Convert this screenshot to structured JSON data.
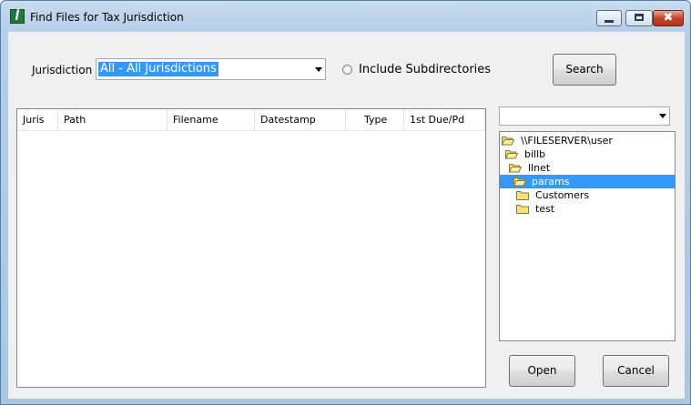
{
  "window": {
    "title": "Find Files for Tax Jurisdiction",
    "app_icon": "green-document-icon",
    "controls": {
      "minimize": "minimize-icon",
      "maximize": "maximize-icon",
      "close": "✖"
    }
  },
  "filters": {
    "jurisdiction_label": "Jurisdiction",
    "jurisdiction_value": "All - All Jurisdictions",
    "include_subdirs_label": "Include Subdirectories",
    "include_subdirs_checked": false,
    "search_label": "Search"
  },
  "results": {
    "columns": [
      "Juris",
      "Path",
      "Filename",
      "Datestamp",
      "Type",
      "1st Due/Pd"
    ],
    "rows": []
  },
  "drive": {
    "value": ""
  },
  "tree": {
    "nodes": [
      {
        "label": "\\\\FILESERVER\\user",
        "depth": 0,
        "state": "open",
        "selected": false
      },
      {
        "label": "billb",
        "depth": 1,
        "state": "open",
        "selected": false
      },
      {
        "label": "llnet",
        "depth": 2,
        "state": "open",
        "selected": false
      },
      {
        "label": "params",
        "depth": 3,
        "state": "open",
        "selected": true
      },
      {
        "label": "Customers",
        "depth": 4,
        "state": "closed",
        "selected": false
      },
      {
        "label": "test",
        "depth": 4,
        "state": "closed",
        "selected": false
      }
    ]
  },
  "actions": {
    "open_label": "Open",
    "cancel_label": "Cancel"
  },
  "colors": {
    "selection": "#3399ff",
    "folder": "#f5e27a",
    "title_bar": "#b9d1ea"
  }
}
